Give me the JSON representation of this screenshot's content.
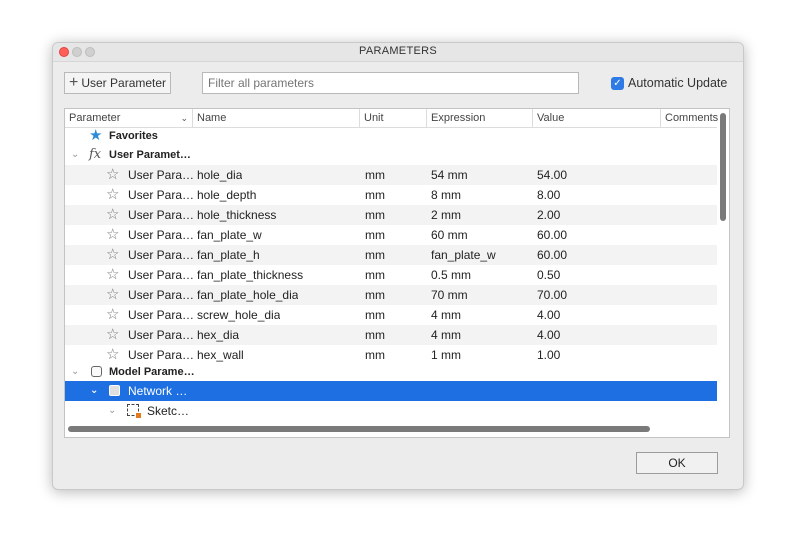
{
  "window": {
    "title": "PARAMETERS"
  },
  "toolbar": {
    "add_button_label": "User Parameter",
    "filter_placeholder": "Filter all parameters",
    "auto_update_label": "Automatic Update",
    "auto_update_checked": true
  },
  "table": {
    "columns": [
      "Parameter",
      "Name",
      "Unit",
      "Expression",
      "Value",
      "Comments"
    ],
    "favorites_label": "Favorites",
    "user_group_label": "User Paramet…",
    "user_rows": [
      {
        "param": "User Para…",
        "name": "hole_dia",
        "unit": "mm",
        "expression": "54 mm",
        "value": "54.00"
      },
      {
        "param": "User Para…",
        "name": "hole_depth",
        "unit": "mm",
        "expression": "8 mm",
        "value": "8.00"
      },
      {
        "param": "User Para…",
        "name": "hole_thickness",
        "unit": "mm",
        "expression": "2 mm",
        "value": "2.00"
      },
      {
        "param": "User Para…",
        "name": "fan_plate_w",
        "unit": "mm",
        "expression": "60 mm",
        "value": "60.00"
      },
      {
        "param": "User Para…",
        "name": "fan_plate_h",
        "unit": "mm",
        "expression": "fan_plate_w",
        "value": "60.00"
      },
      {
        "param": "User Para…",
        "name": "fan_plate_thickness",
        "unit": "mm",
        "expression": "0.5 mm",
        "value": "0.50"
      },
      {
        "param": "User Para…",
        "name": "fan_plate_hole_dia",
        "unit": "mm",
        "expression": "70 mm",
        "value": "70.00"
      },
      {
        "param": "User Para…",
        "name": "screw_hole_dia",
        "unit": "mm",
        "expression": "4 mm",
        "value": "4.00"
      },
      {
        "param": "User Para…",
        "name": "hex_dia",
        "unit": "mm",
        "expression": "4 mm",
        "value": "4.00"
      },
      {
        "param": "User Para…",
        "name": "hex_wall",
        "unit": "mm",
        "expression": "1 mm",
        "value": "1.00"
      }
    ],
    "model_group_label": "Model Parame…",
    "network_label": "Network …",
    "sketch_label": "Sketc…"
  },
  "footer": {
    "ok_label": "OK"
  },
  "colors": {
    "selection": "#1d6fe2",
    "favorite_star": "#2d8bd6",
    "checkbox": "#2e7be5"
  }
}
